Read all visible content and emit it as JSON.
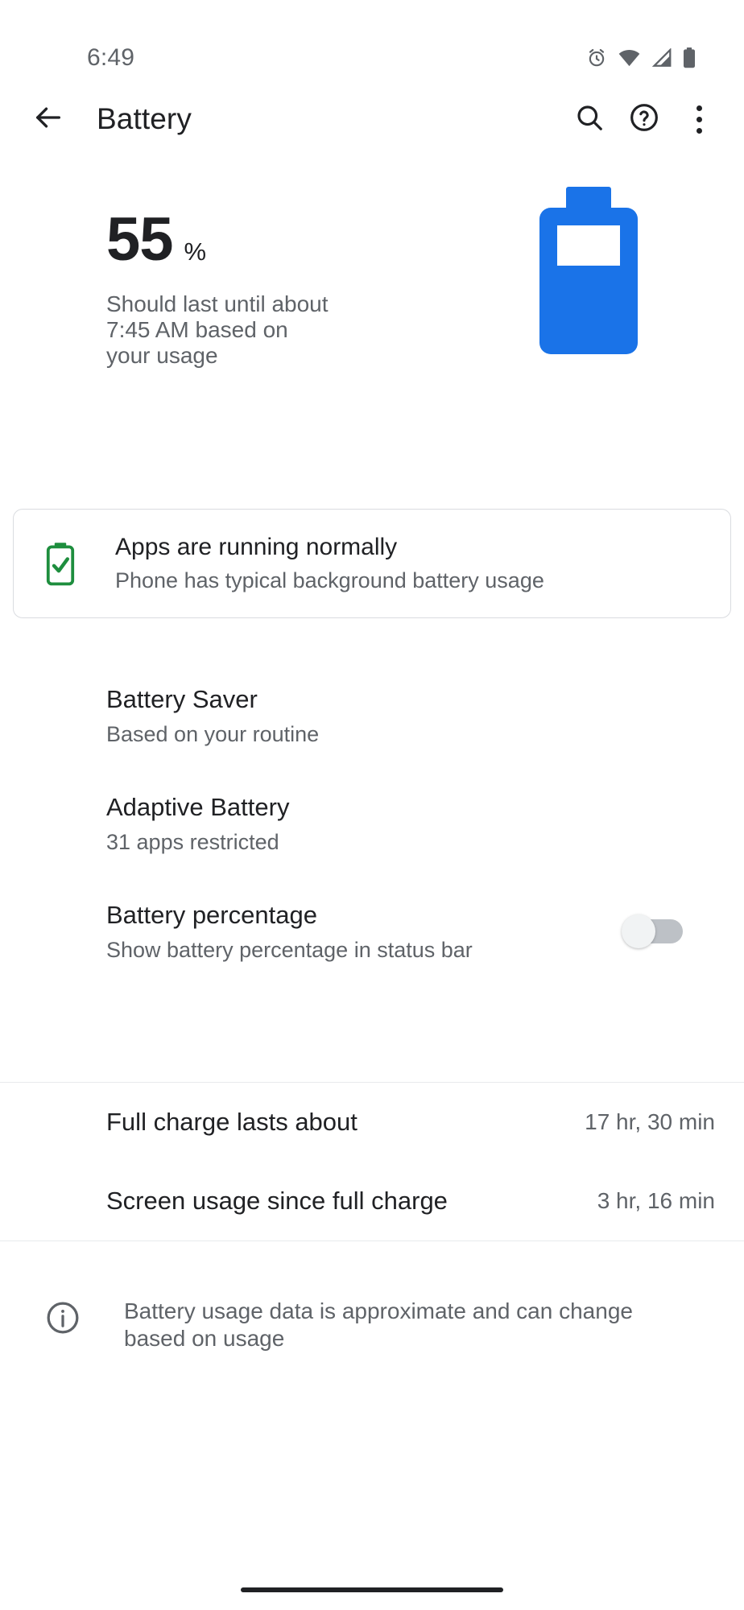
{
  "status_bar": {
    "time": "6:49",
    "icons": [
      "alarm-icon",
      "wifi-icon",
      "signal-icon",
      "battery-icon"
    ]
  },
  "toolbar": {
    "back_label": "back-arrow-icon",
    "title": "Battery",
    "search_label": "search-icon",
    "help_label": "help-icon",
    "overflow_label": "more-options-icon"
  },
  "summary": {
    "percent": "55",
    "percent_unit": "%",
    "description": "Should last until about 7:45 AM based on your usage",
    "battery_fill_percent": 55,
    "battery_color": "#1a73e8"
  },
  "tip_card": {
    "icon": "battery-check-icon",
    "icon_color": "#1e8e3e",
    "title": "Apps are running normally",
    "subtitle": "Phone has typical background battery usage"
  },
  "preferences": [
    {
      "title": "Battery Saver",
      "subtitle": "Based on your routine",
      "has_switch": false
    },
    {
      "title": "Adaptive Battery",
      "subtitle": "31 apps restricted",
      "has_switch": false
    },
    {
      "title": "Battery percentage",
      "subtitle": "Show battery percentage in status bar",
      "has_switch": true,
      "switch_on": false
    }
  ],
  "stats": [
    {
      "label": "Full charge lasts about",
      "value": "17 hr, 30 min"
    },
    {
      "label": "Screen usage since full charge",
      "value": "3 hr, 16 min"
    }
  ],
  "footer": {
    "icon": "info-icon",
    "text": "Battery usage data is approximate and can change based on usage"
  }
}
